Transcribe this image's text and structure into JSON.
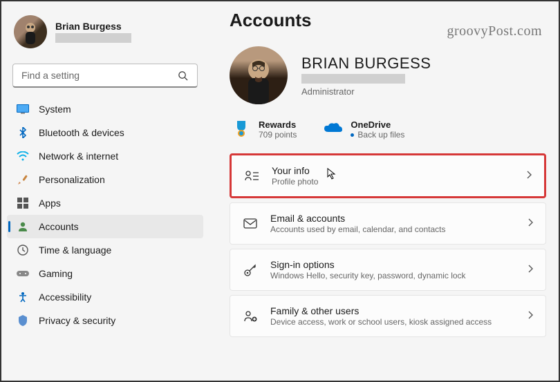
{
  "watermark": "groovyPost.com",
  "user": {
    "name": "Brian Burgess"
  },
  "search": {
    "placeholder": "Find a setting"
  },
  "sidebar": {
    "items": [
      {
        "label": "System",
        "icon": "system-icon"
      },
      {
        "label": "Bluetooth & devices",
        "icon": "bluetooth-icon"
      },
      {
        "label": "Network & internet",
        "icon": "wifi-icon"
      },
      {
        "label": "Personalization",
        "icon": "personalization-icon"
      },
      {
        "label": "Apps",
        "icon": "apps-icon"
      },
      {
        "label": "Accounts",
        "icon": "accounts-icon"
      },
      {
        "label": "Time & language",
        "icon": "time-icon"
      },
      {
        "label": "Gaming",
        "icon": "gaming-icon"
      },
      {
        "label": "Accessibility",
        "icon": "accessibility-icon"
      },
      {
        "label": "Privacy & security",
        "icon": "privacy-icon"
      }
    ]
  },
  "page": {
    "title": "Accounts"
  },
  "account": {
    "display_name": "BRIAN BURGESS",
    "role": "Administrator"
  },
  "status": {
    "rewards": {
      "title": "Rewards",
      "sub": "709 points"
    },
    "onedrive": {
      "title": "OneDrive",
      "sub": "Back up files"
    }
  },
  "settings": [
    {
      "title": "Your info",
      "sub": "Profile photo"
    },
    {
      "title": "Email & accounts",
      "sub": "Accounts used by email, calendar, and contacts"
    },
    {
      "title": "Sign-in options",
      "sub": "Windows Hello, security key, password, dynamic lock"
    },
    {
      "title": "Family & other users",
      "sub": "Device access, work or school users, kiosk assigned access"
    }
  ]
}
